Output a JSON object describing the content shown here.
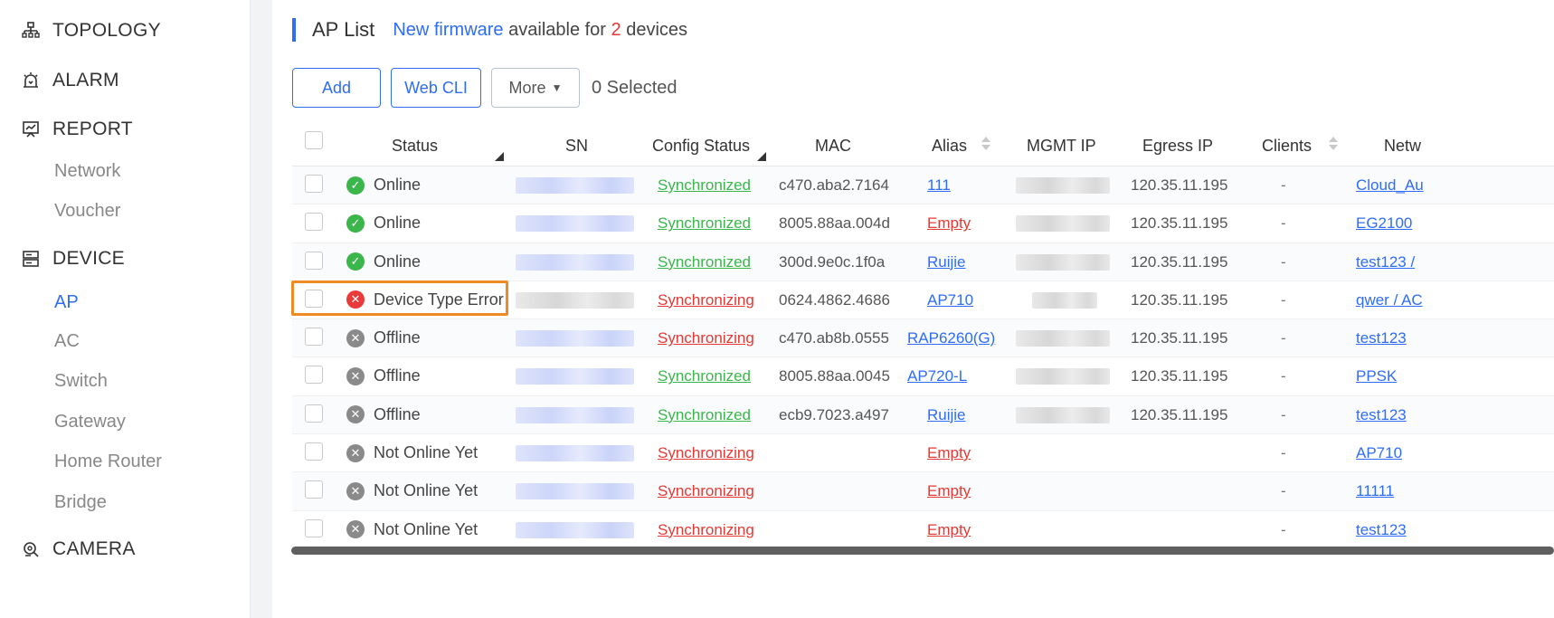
{
  "sidebar": {
    "items": [
      {
        "label": "TOPOLOGY",
        "icon": "topology-icon"
      },
      {
        "label": "ALARM",
        "icon": "alarm-icon"
      },
      {
        "label": "REPORT",
        "icon": "report-icon"
      },
      {
        "label": "DEVICE",
        "icon": "device-icon"
      },
      {
        "label": "CAMERA",
        "icon": "camera-icon"
      }
    ],
    "report_sub": [
      "Network",
      "Voucher"
    ],
    "device_sub": [
      "AP",
      "AC",
      "Switch",
      "Gateway",
      "Home Router",
      "Bridge"
    ],
    "active_sub": "AP"
  },
  "header": {
    "title": "AP List",
    "fw_link": "New firmware",
    "fw_text1": "available for",
    "fw_count": "2",
    "fw_text2": "devices"
  },
  "toolbar": {
    "add_label": "Add",
    "webcli_label": "Web CLI",
    "more_label": "More",
    "selected_text": "0 Selected"
  },
  "table": {
    "columns": [
      "Status",
      "SN",
      "Config Status",
      "MAC",
      "Alias",
      "MGMT IP",
      "Egress IP",
      "Clients",
      "Netw"
    ],
    "rows": [
      {
        "status": "Online",
        "state": "online",
        "config": "Synchronized",
        "mac": "c470.aba2.7164",
        "alias": "111",
        "egress": "120.35.11.195",
        "clients": "-",
        "network": "Cloud_Au"
      },
      {
        "status": "Online",
        "state": "online",
        "config": "Synchronized",
        "mac": "8005.88aa.004d",
        "alias": "Empty",
        "egress": "120.35.11.195",
        "clients": "-",
        "network": "EG2100"
      },
      {
        "status": "Online",
        "state": "online",
        "config": "Synchronized",
        "mac": "300d.9e0c.1f0a",
        "alias": "Ruijie",
        "egress": "120.35.11.195",
        "clients": "-",
        "network": "test123 /"
      },
      {
        "status": "Device Type Error",
        "state": "error",
        "config": "Synchronizing",
        "mac": "0624.4862.4686",
        "alias": "AP710",
        "egress": "120.35.11.195",
        "clients": "-",
        "network": "qwer / AC"
      },
      {
        "status": "Offline",
        "state": "offline",
        "config": "Synchronizing",
        "mac": "c470.ab8b.0555",
        "alias": "RAP6260(G)",
        "egress": "120.35.11.195",
        "clients": "-",
        "network": "test123"
      },
      {
        "status": "Offline",
        "state": "offline",
        "config": "Synchronized",
        "mac": "8005.88aa.0045",
        "alias": "AP720-L",
        "egress": "120.35.11.195",
        "clients": "-",
        "network": "PPSK"
      },
      {
        "status": "Offline",
        "state": "offline",
        "config": "Synchronized",
        "mac": "ecb9.7023.a497",
        "alias": "Ruijie",
        "egress": "120.35.11.195",
        "clients": "-",
        "network": "test123"
      },
      {
        "status": "Not Online Yet",
        "state": "offline",
        "config": "Synchronizing",
        "mac": "",
        "alias": "Empty",
        "egress": "",
        "clients": "-",
        "network": "AP710"
      },
      {
        "status": "Not Online Yet",
        "state": "offline",
        "config": "Synchronizing",
        "mac": "",
        "alias": "Empty",
        "egress": "",
        "clients": "-",
        "network": "11111"
      },
      {
        "status": "Not Online Yet",
        "state": "offline",
        "config": "Synchronizing",
        "mac": "",
        "alias": "Empty",
        "egress": "",
        "clients": "-",
        "network": "test123"
      }
    ]
  },
  "colors": {
    "accent": "#2f6df6",
    "online": "#3bb64b",
    "error": "#ea3b3b",
    "offline": "#8a8a8a",
    "highlight": "#f08a24"
  }
}
